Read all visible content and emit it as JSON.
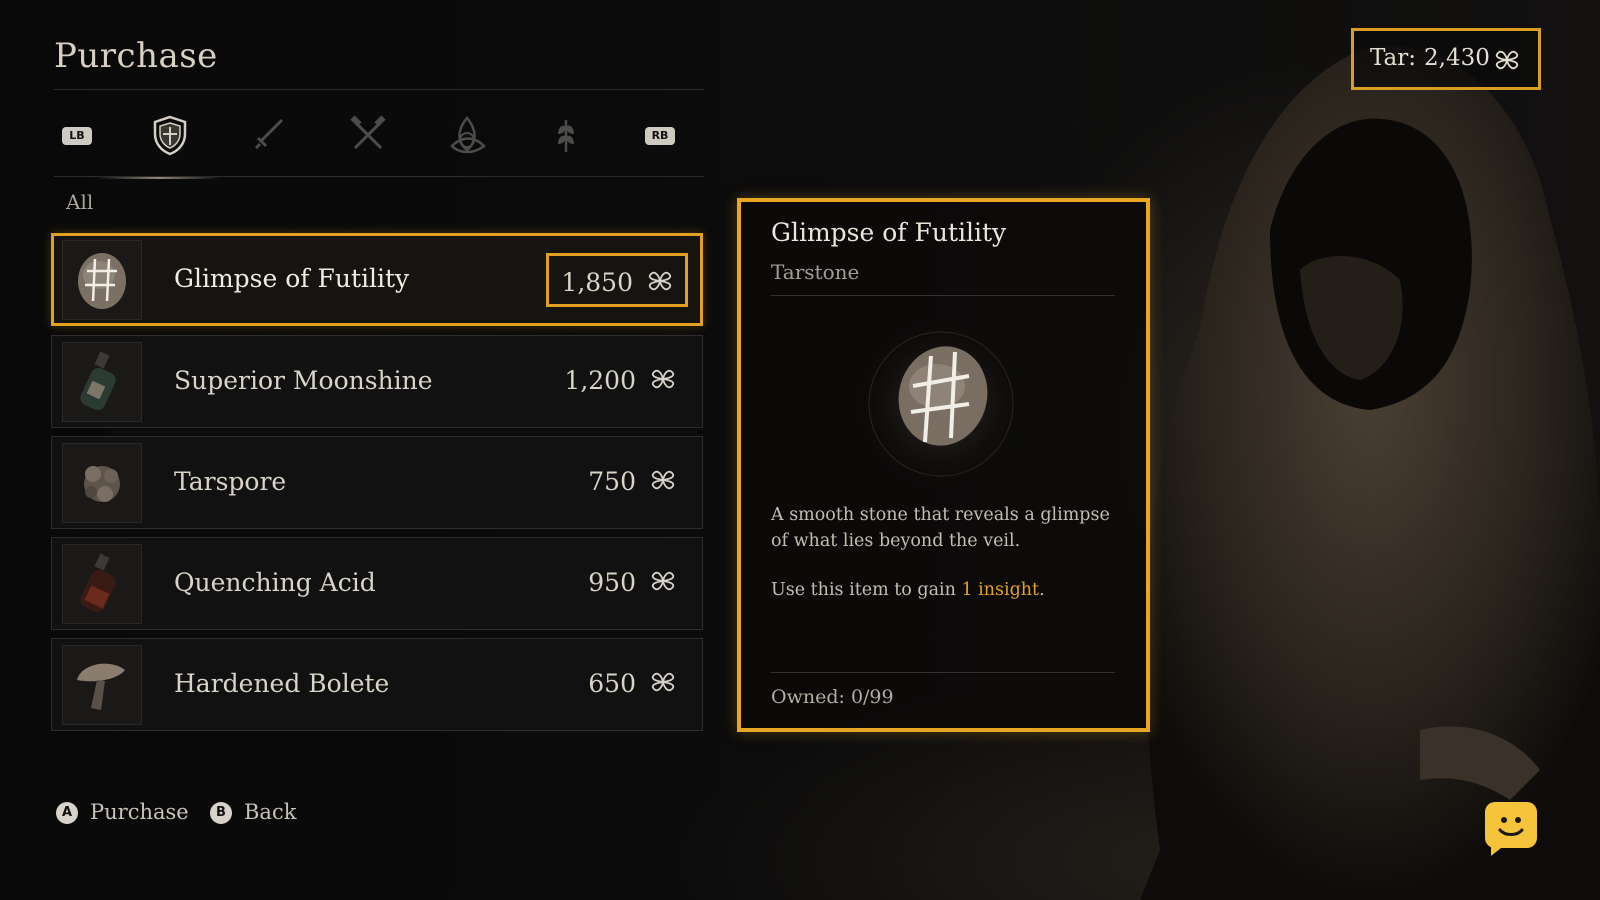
{
  "header": {
    "title": "Purchase"
  },
  "tabs": {
    "left_bumper": "LB",
    "right_bumper": "RB",
    "items": [
      {
        "icon": "shield-icon",
        "active": true
      },
      {
        "icon": "sword-icon",
        "active": false
      },
      {
        "icon": "crossed-hammers-icon",
        "active": false
      },
      {
        "icon": "triquetra-icon",
        "active": false
      },
      {
        "icon": "wheat-icon",
        "active": false
      }
    ]
  },
  "category": "All",
  "items": [
    {
      "name": "Glimpse of Futility",
      "price": "1,850",
      "icon": "tarstone-icon",
      "selected": true
    },
    {
      "name": "Superior Moonshine",
      "price": "1,200",
      "icon": "bottle-icon",
      "selected": false
    },
    {
      "name": "Tarspore",
      "price": "750",
      "icon": "spore-icon",
      "selected": false
    },
    {
      "name": "Quenching Acid",
      "price": "950",
      "icon": "acid-bottle-icon",
      "selected": false
    },
    {
      "name": "Hardened Bolete",
      "price": "650",
      "icon": "mushroom-icon",
      "selected": false
    }
  ],
  "detail": {
    "title": "Glimpse of Futility",
    "subtitle": "Tarstone",
    "description": "A smooth stone that reveals a glimpse of what lies beyond the veil.",
    "use_prefix": "Use this item to gain ",
    "use_highlight": "1 insight",
    "use_suffix": ".",
    "owned_label": "Owned:",
    "owned_value": "0/99"
  },
  "currency": {
    "label": "Tar:",
    "amount": "2,430",
    "icon": "tar-coin-icon"
  },
  "footer": {
    "purchase_button": "A",
    "purchase_label": "Purchase",
    "back_button": "B",
    "back_label": "Back"
  },
  "colors": {
    "accent": "#e2a020",
    "highlight_text": "#e5a02a"
  }
}
